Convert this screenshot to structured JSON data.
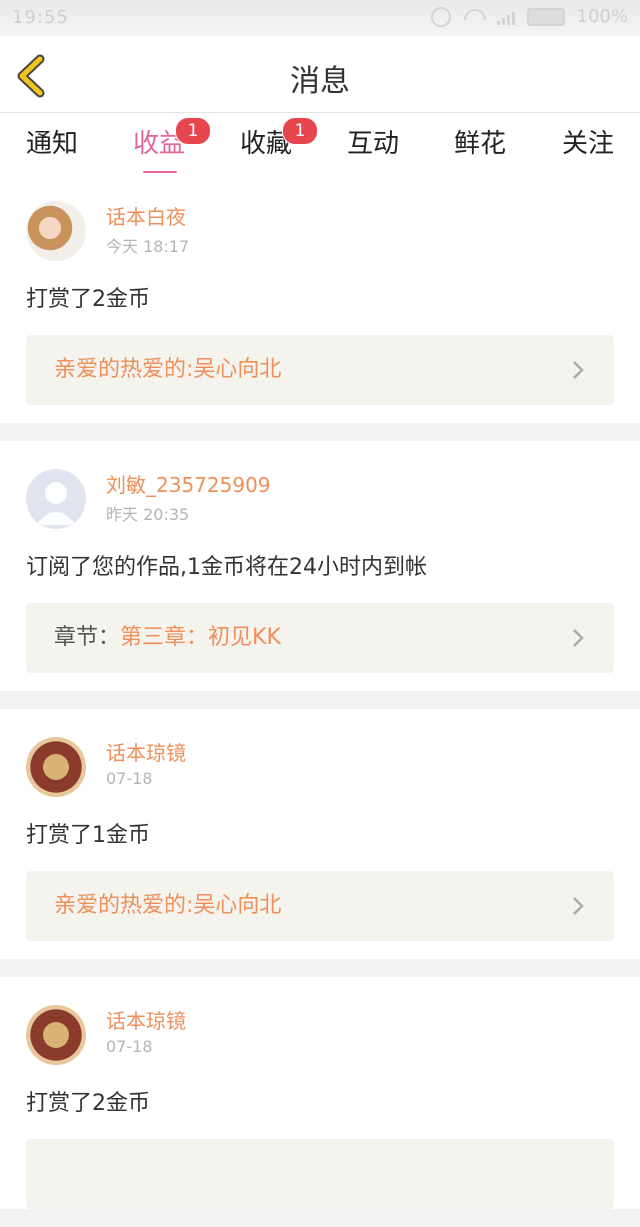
{
  "status_bar": {
    "time": "19:55",
    "battery": "100%"
  },
  "header": {
    "title": "消息"
  },
  "tabs": [
    {
      "label": "通知",
      "active": false
    },
    {
      "label": "收益",
      "active": true,
      "badge": "1"
    },
    {
      "label": "收藏",
      "active": false,
      "badge": "1"
    },
    {
      "label": "互动",
      "active": false
    },
    {
      "label": "鲜花",
      "active": false
    },
    {
      "label": "关注",
      "active": false
    }
  ],
  "messages": [
    {
      "user": "话本白夜",
      "time": "今天 18:17",
      "action": "打赏了2金币",
      "link": {
        "prefix": "",
        "text": "亲爱的热爱的:吴心向北"
      }
    },
    {
      "user": "刘敏_235725909",
      "time": "昨天 20:35",
      "action": "订阅了您的作品,1金币将在24小时内到帐",
      "link": {
        "prefix": "章节：",
        "text": "第三章：初见KK"
      }
    },
    {
      "user": "话本琼镜",
      "time": "07-18",
      "action": "打赏了1金币",
      "link": {
        "prefix": "",
        "text": "亲爱的热爱的:吴心向北"
      }
    },
    {
      "user": "话本琼镜",
      "time": "07-18",
      "action": "打赏了2金币",
      "link": {
        "prefix": "",
        "text": ""
      }
    }
  ],
  "colors": {
    "accent": "#e0669a",
    "username": "#ef8f5a",
    "badge": "#e8464f",
    "back_icon": "#f0c419"
  }
}
